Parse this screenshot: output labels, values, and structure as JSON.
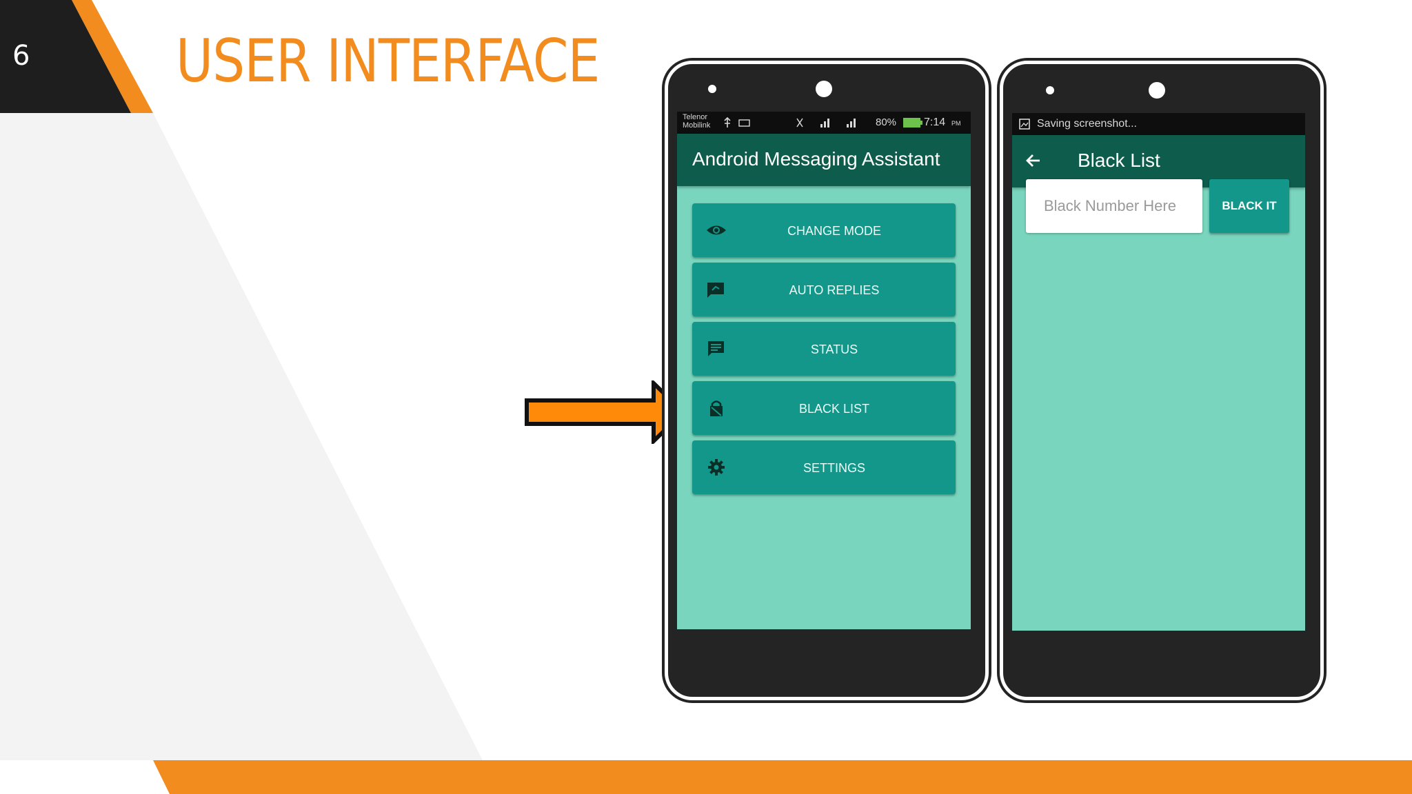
{
  "slide": {
    "number": "6",
    "title": "USER INTERFACE",
    "colors": {
      "accent": "#f28c1e",
      "dark": "#1e1e1e",
      "grey_panel": "#f3f3f3"
    }
  },
  "phone1": {
    "status": {
      "carrier_line1": "Telenor",
      "carrier_line2": "Mobilink",
      "battery": "80%",
      "time": "7:14",
      "ampm": "PM"
    },
    "app_title": "Android Messaging Assistant",
    "menu": [
      {
        "label": "CHANGE MODE",
        "icon": "eye-icon"
      },
      {
        "label": "AUTO REPLIES",
        "icon": "reply-icon"
      },
      {
        "label": "STATUS",
        "icon": "message-icon"
      },
      {
        "label": "BLACK LIST",
        "icon": "lock-icon"
      },
      {
        "label": "SETTINGS",
        "icon": "gear-icon"
      }
    ]
  },
  "phone2": {
    "status_text": "Saving screenshot...",
    "title": "Black List",
    "input_placeholder": "Black Number Here",
    "button_label": "BLACK IT"
  },
  "colors": {
    "screen_bg": "#79d5bd",
    "appbar": "#0d5c4c",
    "button": "#12978a",
    "arrow": "#ff8a0a"
  }
}
